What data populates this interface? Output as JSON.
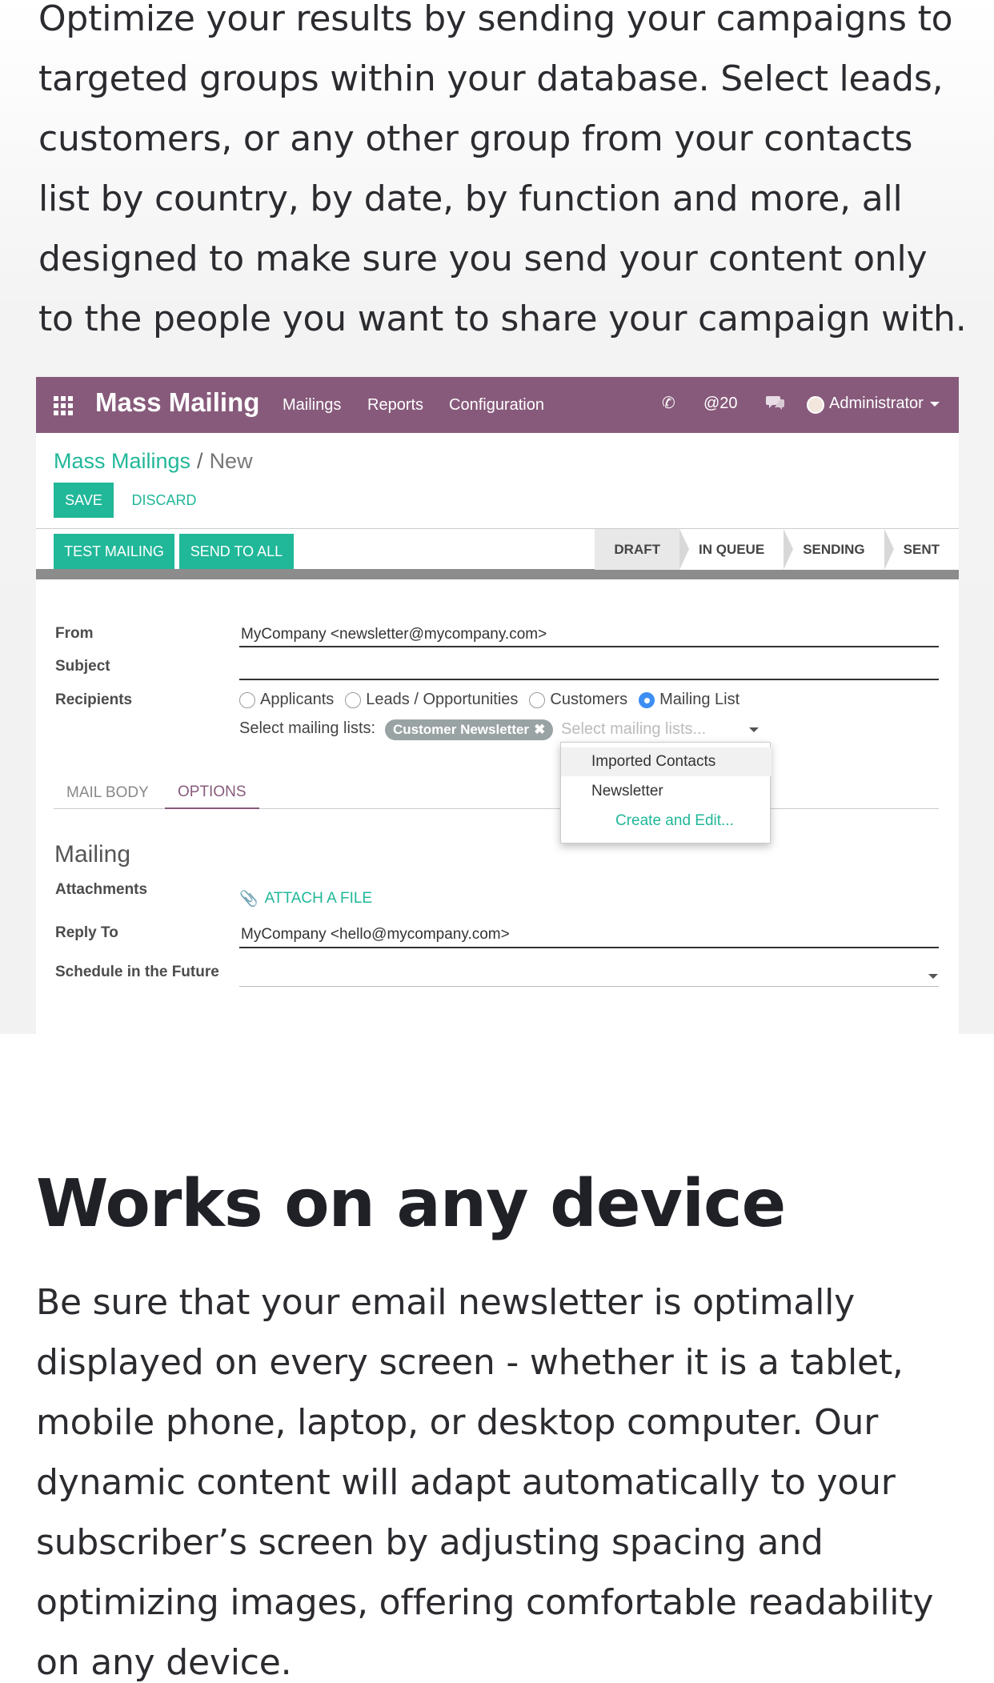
{
  "intro": {
    "text": "Optimize your results by sending your campaigns to targeted groups within your database. Select leads, customers, or any other group from your contacts list by country, by date, by function and more, all designed to make sure you send your content only to the people you want to share your campaign with."
  },
  "app": {
    "brand": "Mass Mailing",
    "menu": [
      "Mailings",
      "Reports",
      "Configuration"
    ],
    "mentions": "@20",
    "user": "Administrator",
    "brand_color": "#875a7b",
    "accent_color": "#21b799"
  },
  "breadcrumb": {
    "parent": "Mass Mailings",
    "separator": "/",
    "current": "New"
  },
  "actions": {
    "save": "SAVE",
    "discard": "DISCARD",
    "test_mailing": "TEST MAILING",
    "send_to_all": "SEND TO ALL"
  },
  "stages": [
    "DRAFT",
    "IN QUEUE",
    "SENDING",
    "SENT"
  ],
  "current_stage": "DRAFT",
  "form": {
    "from_label": "From",
    "from_value": "MyCompany <newsletter@mycompany.com>",
    "subject_label": "Subject",
    "subject_value": "",
    "recipients_label": "Recipients",
    "recipient_options": [
      "Applicants",
      "Leads / Opportunities",
      "Customers",
      "Mailing List"
    ],
    "recipient_selected": "Mailing List",
    "mailing_lists_label": "Select mailing lists:",
    "mailing_list_tag": "Customer Newsletter",
    "mailing_list_placeholder": "Select mailing lists...",
    "dropdown_options": [
      "Imported Contacts",
      "Newsletter"
    ],
    "dropdown_create": "Create and Edit..."
  },
  "tabs": [
    "MAIL BODY",
    "OPTIONS"
  ],
  "active_tab": "OPTIONS",
  "options": {
    "section_title": "Mailing",
    "attachments_label": "Attachments",
    "attach_button": "ATTACH A FILE",
    "reply_to_label": "Reply To",
    "reply_to_value": "MyCompany <hello@mycompany.com>",
    "schedule_label": "Schedule in the Future",
    "schedule_value": ""
  },
  "section2": {
    "heading_light": "Works on",
    "heading_bold": "any device",
    "text": "Be sure that your email newsletter is optimally displayed on every screen - whether it is a tablet, mobile phone, laptop, or desktop computer. Our dynamic content will adapt automatically to your subscriber’s screen by adjusting spacing and optimizing images, offering comfortable readability on any device."
  }
}
